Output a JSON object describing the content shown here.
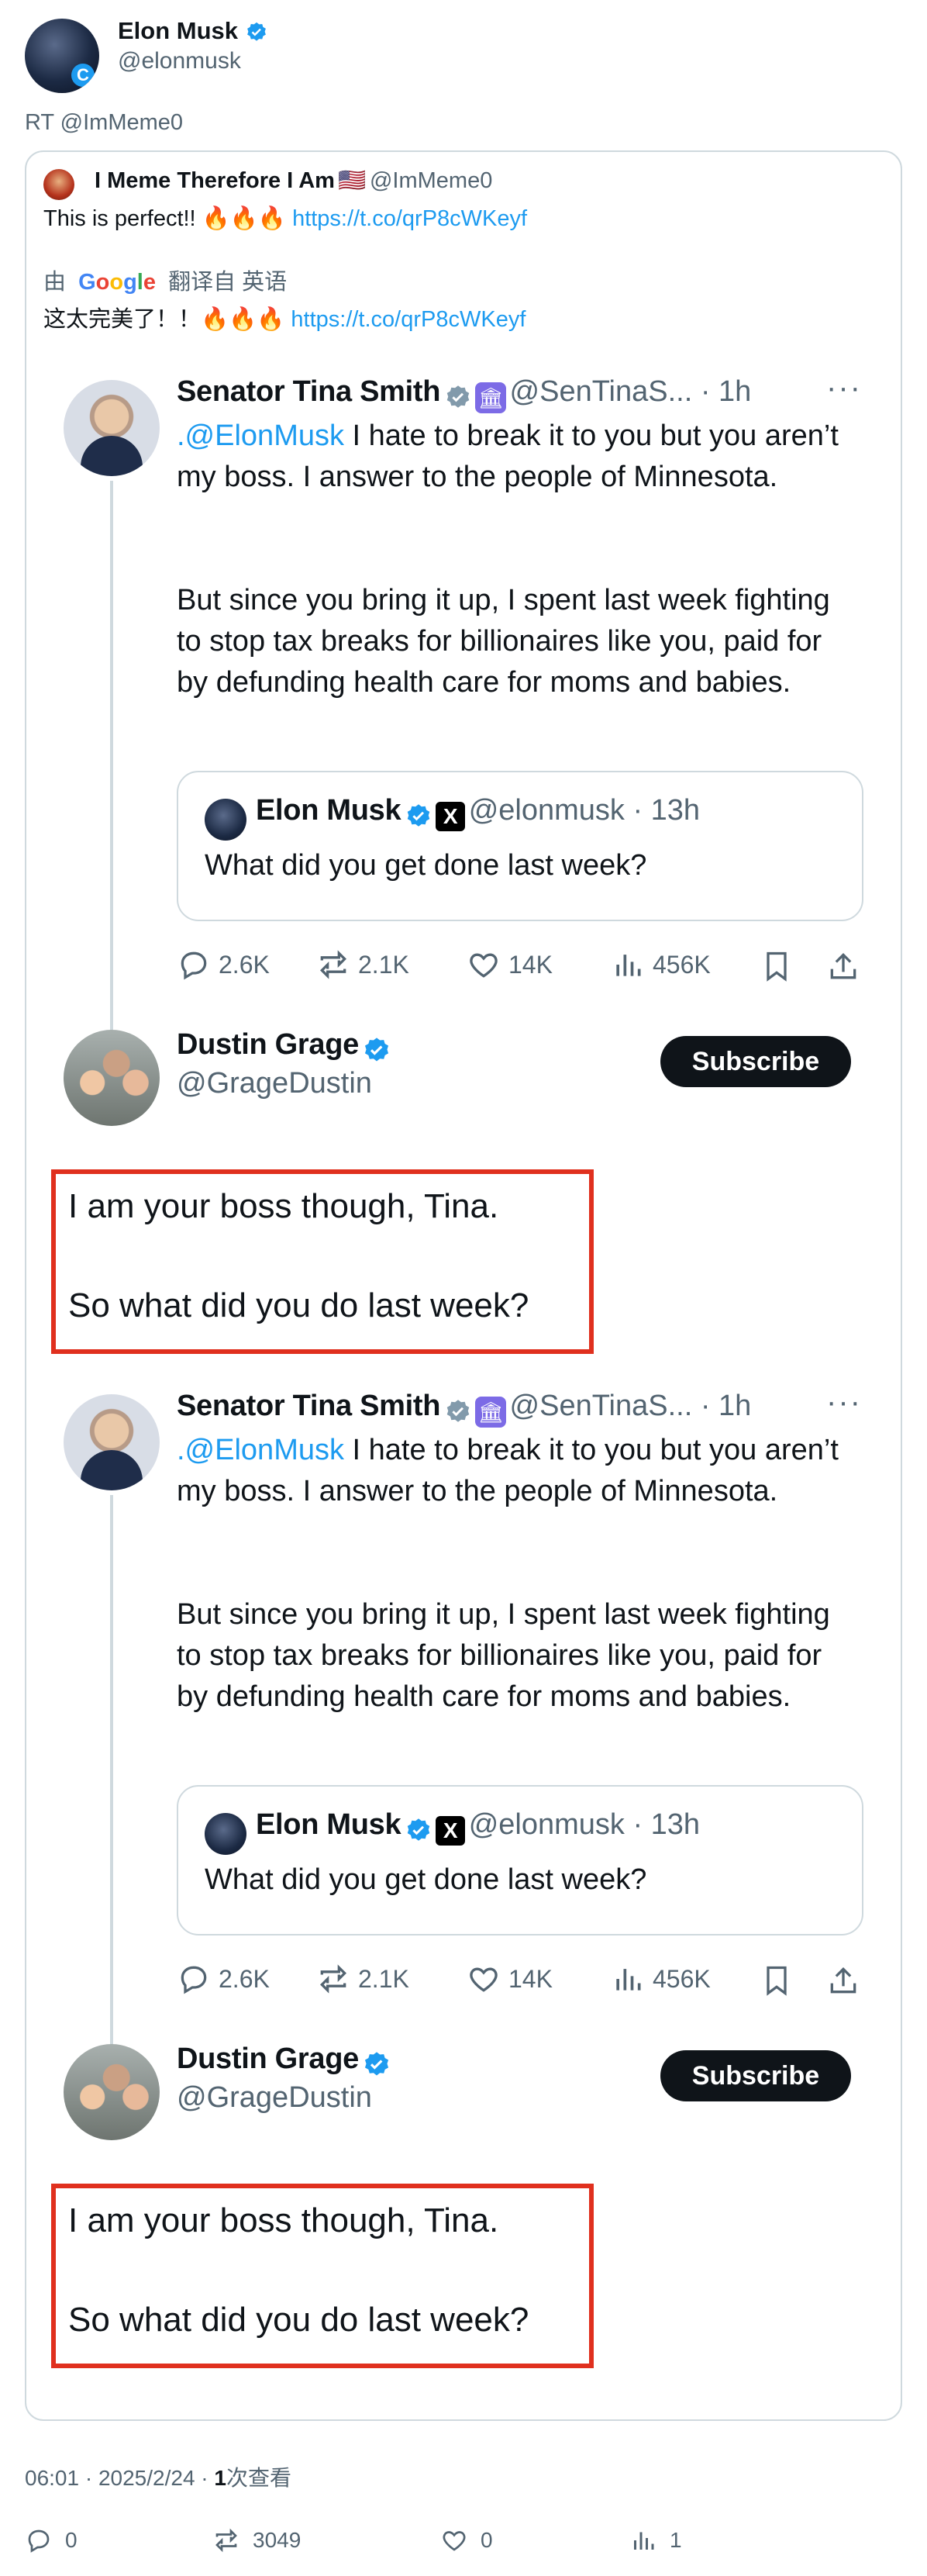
{
  "author": {
    "name": "Elon Musk",
    "handle": "@elonmusk",
    "avatar_badge": "C"
  },
  "retweet_line": "RT @ImMeme0",
  "quoted": {
    "name": "I Meme Therefore I Am",
    "flag": "🇺🇸",
    "handle": "@ImMeme0",
    "text": "This is perfect!! 🔥🔥🔥",
    "link": "https://t.co/qrP8cWKeyf",
    "translate_prefix": "由",
    "translate_brand": "Google",
    "translate_suffix": "翻译自 英语",
    "translated_text": "这太完美了！！🔥🔥🔥",
    "translated_link": "https://t.co/qrP8cWKeyf"
  },
  "screenshot": {
    "tina": {
      "name": "Senator Tina Smith",
      "handle_time": "@SenTinaS... · 1h",
      "mention": ".@ElonMusk",
      "text1": " I hate to break it to you but you aren’t my boss. I answer to the people of Minnesota.",
      "text2": "But since you bring it up, I spent last week fighting to stop tax breaks for billionaires like you, paid for by defunding health care for moms and babies."
    },
    "elon_quote": {
      "name": "Elon Musk",
      "handle_time": "@elonmusk · 13h",
      "x_label": "X",
      "text": "What did you get done last week?"
    },
    "actions": {
      "replies": "2.6K",
      "retweets": "2.1K",
      "likes": "14K",
      "views": "456K"
    },
    "dustin": {
      "name": "Dustin Grage",
      "handle": "@GrageDustin",
      "subscribe": "Subscribe",
      "line1": "I am your boss though, Tina.",
      "line2": "So what did you do last week?"
    }
  },
  "meta": {
    "time": "06:01 · 2025/2/24 · ",
    "views_count": "1",
    "views_label": "次查看"
  },
  "stats": {
    "replies": "0",
    "retweets": "3049",
    "likes": "0",
    "views": "1"
  },
  "colors": {
    "link": "#1d9bf0",
    "verified": "#1d9bf0",
    "highlight_box": "#e0301e",
    "gray": "#536471"
  }
}
